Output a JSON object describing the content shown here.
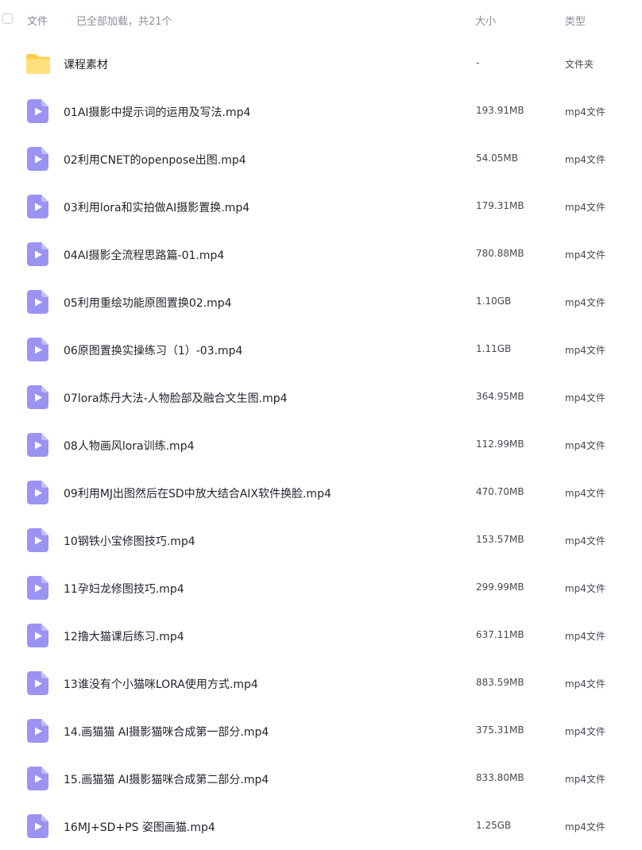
{
  "header": {
    "name_col": "文件",
    "status": "已全部加载，共21个",
    "size_col": "大小",
    "type_col": "类型"
  },
  "colors": {
    "folder": "#ffcf4a",
    "video_icon": "#9b93f2"
  },
  "files": [
    {
      "name": "课程素材",
      "size": "-",
      "type": "文件夹",
      "icon": "folder-icon"
    },
    {
      "name": "01AI摄影中提示词的运用及写法.mp4",
      "size": "193.91MB",
      "type": "mp4文件",
      "icon": "video-file-icon"
    },
    {
      "name": "02利用CNET的openpose出图.mp4",
      "size": "54.05MB",
      "type": "mp4文件",
      "icon": "video-file-icon"
    },
    {
      "name": "03利用lora和实拍做AI摄影置换.mp4",
      "size": "179.31MB",
      "type": "mp4文件",
      "icon": "video-file-icon"
    },
    {
      "name": "04AI摄影全流程思路篇-01.mp4",
      "size": "780.88MB",
      "type": "mp4文件",
      "icon": "video-file-icon"
    },
    {
      "name": "05利用重绘功能原图置换02.mp4",
      "size": "1.10GB",
      "type": "mp4文件",
      "icon": "video-file-icon"
    },
    {
      "name": "06原图置换实操练习（1）-03.mp4",
      "size": "1.11GB",
      "type": "mp4文件",
      "icon": "video-file-icon"
    },
    {
      "name": "07lora炼丹大法-人物脸部及融合文生图.mp4",
      "size": "364.95MB",
      "type": "mp4文件",
      "icon": "video-file-icon"
    },
    {
      "name": "08人物画风lora训练.mp4",
      "size": "112.99MB",
      "type": "mp4文件",
      "icon": "video-file-icon"
    },
    {
      "name": "09利用MJ出图然后在SD中放大结合AIX软件换脸.mp4",
      "size": "470.70MB",
      "type": "mp4文件",
      "icon": "video-file-icon"
    },
    {
      "name": "10钢铁小宝修图技巧.mp4",
      "size": "153.57MB",
      "type": "mp4文件",
      "icon": "video-file-icon"
    },
    {
      "name": "11孕妇龙修图技巧.mp4",
      "size": "299.99MB",
      "type": "mp4文件",
      "icon": "video-file-icon"
    },
    {
      "name": "12撸大猫课后练习.mp4",
      "size": "637.11MB",
      "type": "mp4文件",
      "icon": "video-file-icon"
    },
    {
      "name": "13谁没有个小猫咪LORA使用方式.mp4",
      "size": "883.59MB",
      "type": "mp4文件",
      "icon": "video-file-icon"
    },
    {
      "name": "14.画猫猫 AI摄影猫咪合成第一部分.mp4",
      "size": "375.31MB",
      "type": "mp4文件",
      "icon": "video-file-icon"
    },
    {
      "name": "15.画猫猫 AI摄影猫咪合成第二部分.mp4",
      "size": "833.80MB",
      "type": "mp4文件",
      "icon": "video-file-icon"
    },
    {
      "name": "16MJ+SD+PS 姿图画猫.mp4",
      "size": "1.25GB",
      "type": "mp4文件",
      "icon": "video-file-icon"
    }
  ]
}
